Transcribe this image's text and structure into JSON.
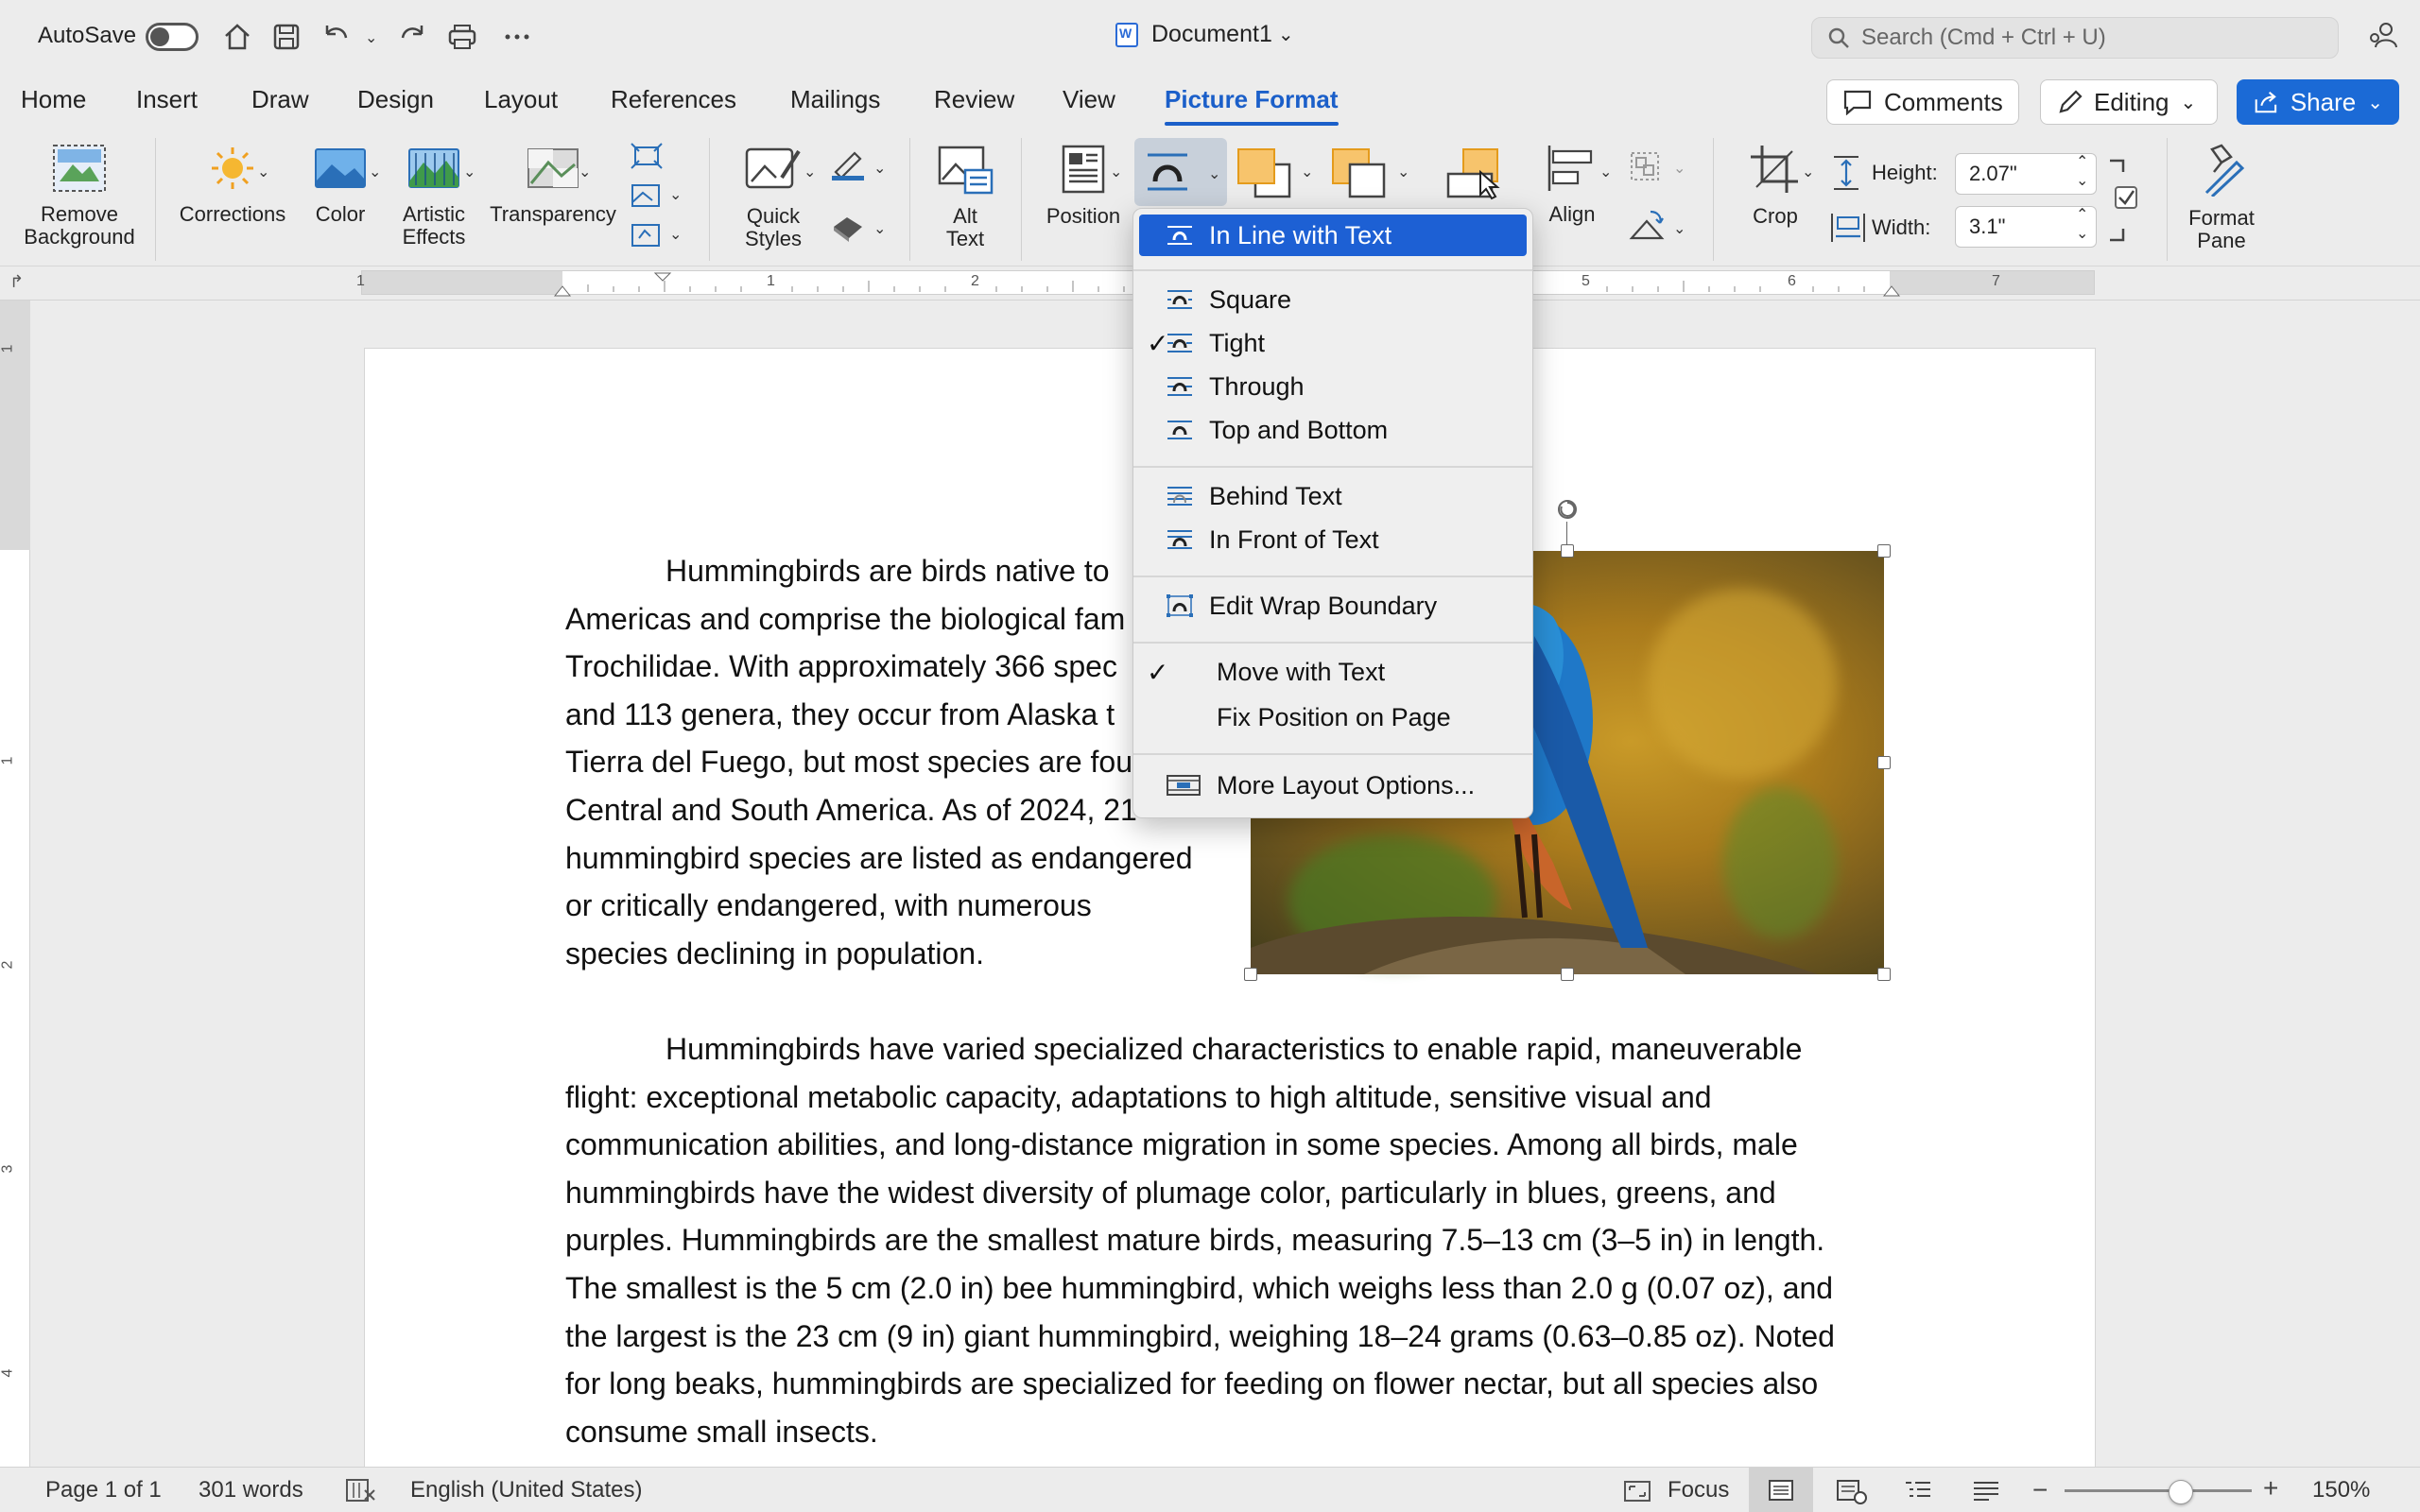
{
  "titlebar": {
    "autosave_label": "AutoSave",
    "doc_title": "Document1",
    "search_placeholder": "Search (Cmd + Ctrl + U)"
  },
  "tabs": [
    {
      "label": "Home"
    },
    {
      "label": "Insert"
    },
    {
      "label": "Draw"
    },
    {
      "label": "Design"
    },
    {
      "label": "Layout"
    },
    {
      "label": "References"
    },
    {
      "label": "Mailings"
    },
    {
      "label": "Review"
    },
    {
      "label": "View"
    },
    {
      "label": "Picture Format"
    }
  ],
  "active_tab": "Picture Format",
  "header_buttons": {
    "comments": "Comments",
    "editing": "Editing",
    "share": "Share"
  },
  "ribbon": {
    "remove_background": [
      "Remove",
      "Background"
    ],
    "corrections": "Corrections",
    "color": "Color",
    "artistic_effects": [
      "Artistic",
      "Effects"
    ],
    "transparency": "Transparency",
    "quick_styles": [
      "Quick",
      "Styles"
    ],
    "alt_text": [
      "Alt",
      "Text"
    ],
    "position": "Position",
    "align": "Align",
    "crop": "Crop",
    "height_label": "Height:",
    "height_value": "2.07\"",
    "width_label": "Width:",
    "width_value": "3.1\"",
    "format_pane": [
      "Format",
      "Pane"
    ]
  },
  "ruler_numbers": [
    "1",
    "1",
    "2",
    "5",
    "6",
    "7"
  ],
  "vruler_numbers": [
    "1",
    "1",
    "2",
    "3",
    "4"
  ],
  "wrap_menu": {
    "items": [
      {
        "label": "In Line with Text",
        "selected": true,
        "checked": false
      },
      {
        "label": "Square",
        "selected": false,
        "checked": false
      },
      {
        "label": "Tight",
        "selected": false,
        "checked": true
      },
      {
        "label": "Through",
        "selected": false,
        "checked": false
      },
      {
        "label": "Top and Bottom",
        "selected": false,
        "checked": false
      },
      {
        "label": "Behind Text",
        "selected": false,
        "checked": false
      },
      {
        "label": "In Front of Text",
        "selected": false,
        "checked": false
      },
      {
        "label": "Edit Wrap Boundary",
        "selected": false,
        "checked": false
      },
      {
        "label": "Move with Text",
        "selected": false,
        "checked": true
      },
      {
        "label": "Fix Position on Page",
        "selected": false,
        "checked": false
      },
      {
        "label": "More Layout Options...",
        "selected": false,
        "checked": false
      }
    ]
  },
  "document": {
    "para1_lines": [
      "Hummingbirds are birds native to",
      "Americas and comprise the biological fam",
      "Trochilidae. With approximately 366 spec",
      "and 113 genera, they occur from Alaska t",
      "Tierra del Fuego, but most species are fou",
      "Central and South America. As of 2024, 21",
      "hummingbird species are listed as endangered",
      "or critically endangered, with numerous",
      "species declining in population."
    ],
    "para2_lines": [
      "Hummingbirds have varied specialized characteristics to enable rapid, maneuverable",
      "flight: exceptional metabolic capacity, adaptations to high altitude, sensitive visual and",
      "communication abilities, and long-distance migration in some species. Among all birds, male",
      "hummingbirds have the widest diversity of plumage color, particularly in blues, greens, and",
      "purples. Hummingbirds are the smallest mature birds, measuring 7.5–13 cm (3–5 in) in length.",
      "The smallest is the 5 cm (2.0 in) bee hummingbird, which weighs less than 2.0 g (0.07 oz), and",
      "the largest is the 23 cm (9 in) giant hummingbird, weighing 18–24 grams (0.63–0.85 oz). Noted",
      "for long beaks, hummingbirds are specialized for feeding on flower nectar, but all species also",
      "consume small insects."
    ]
  },
  "statusbar": {
    "page": "Page 1 of 1",
    "words": "301 words",
    "language": "English (United States)",
    "focus": "Focus",
    "zoom": "150%",
    "zoom_level": 0.62
  },
  "colors": {
    "accent": "#1b5fc9",
    "share_bg": "#1b6ad6",
    "menu_selected": "#1d60d4"
  }
}
